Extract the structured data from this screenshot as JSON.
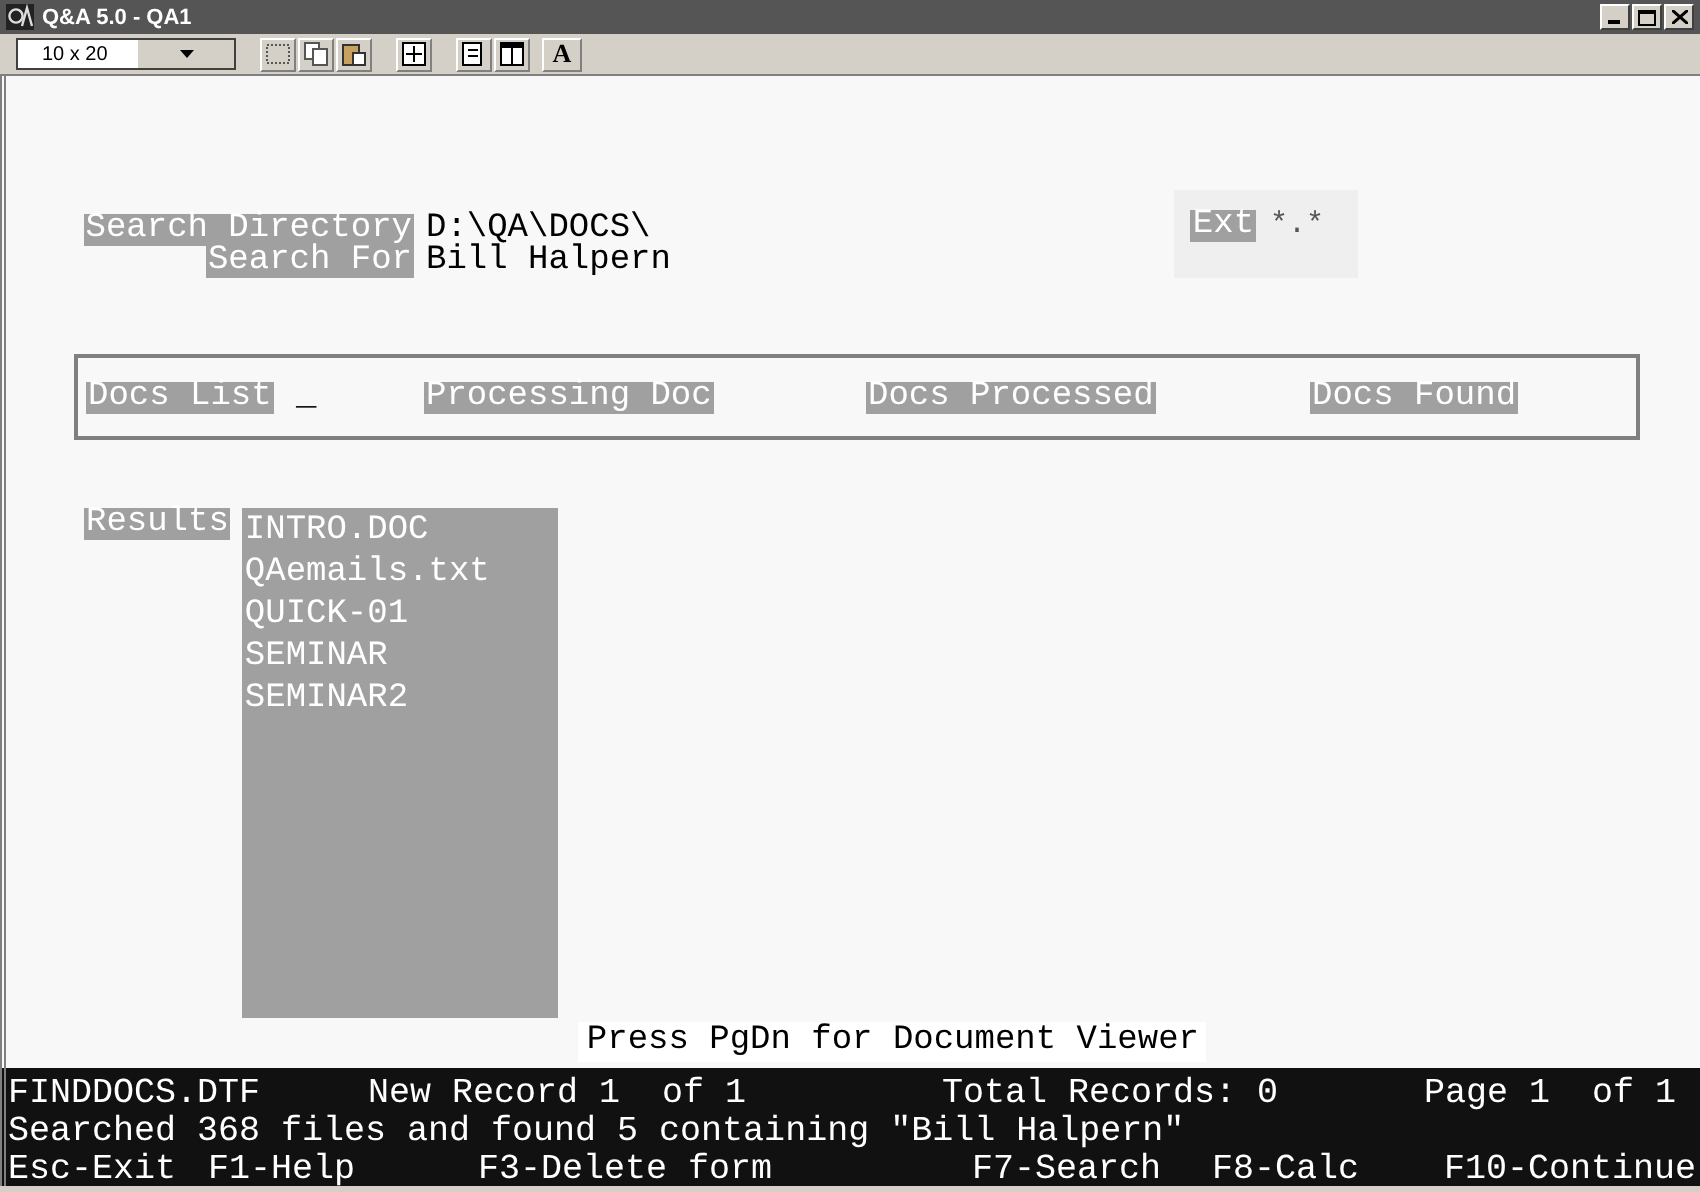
{
  "window": {
    "title": "Q&A 5.0 - QA1"
  },
  "toolbar": {
    "font_size": "10 x 20",
    "font_button": "A"
  },
  "search": {
    "directory_label": "Search Directory",
    "directory": "D:\\QA\\DOCS\\",
    "for_label": "Search For",
    "for": "Bill Halpern",
    "ext_label": "Ext",
    "ext": "*.*"
  },
  "progress": [
    {
      "label": "Docs List",
      "cursor": "_"
    },
    {
      "label": "Processing Doc"
    },
    {
      "label": "Docs Processed"
    },
    {
      "label": "Docs Found"
    }
  ],
  "results": {
    "label": "Results",
    "items": [
      "INTRO.DOC",
      "QAemails.txt",
      "QUICK-01",
      "SEMINAR",
      "SEMINAR2"
    ],
    "hint": "Press PgDn for Document Viewer"
  },
  "status_bar": {
    "line1": [
      "FINDDOCS.DTF",
      "New Record 1",
      "of 1",
      "Total Records: 0",
      "Page 1",
      "of 1"
    ],
    "message": "Searched 368 files and found 5 containing \"Bill Halpern\"",
    "keys": [
      "Esc-Exit",
      "F1-Help",
      "F3-Delete form",
      "F7-Search",
      "F8-Calc",
      "F10-Continue"
    ]
  }
}
